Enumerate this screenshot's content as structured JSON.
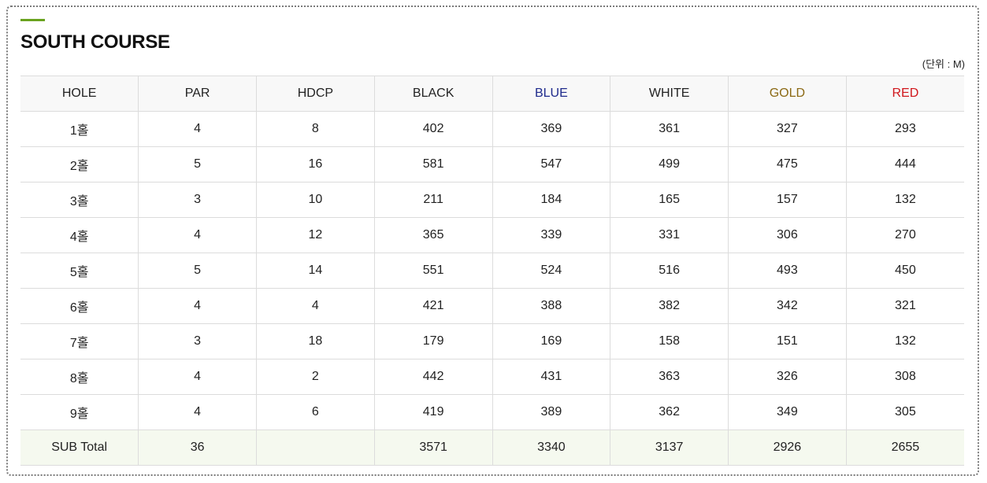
{
  "title": "SOUTH COURSE",
  "unit_label": "(단위 : M)",
  "colors": {
    "accent": "#6aa31f",
    "BLUE": "#1e2a8c",
    "GOLD": "#8b6914",
    "RED": "#d0161b",
    "default_header": "#222222",
    "subtotal_bg": "#f5f9ef",
    "header_bg": "#f8f8f8"
  },
  "table": {
    "headers": [
      {
        "label": "HOLE",
        "color": "#222222"
      },
      {
        "label": "PAR",
        "color": "#222222"
      },
      {
        "label": "HDCP",
        "color": "#222222"
      },
      {
        "label": "BLACK",
        "color": "#222222"
      },
      {
        "label": "BLUE",
        "color": "#1e2a8c"
      },
      {
        "label": "WHITE",
        "color": "#222222"
      },
      {
        "label": "GOLD",
        "color": "#8b6914"
      },
      {
        "label": "RED",
        "color": "#d0161b"
      }
    ],
    "rows": [
      [
        "1홀",
        "4",
        "8",
        "402",
        "369",
        "361",
        "327",
        "293"
      ],
      [
        "2홀",
        "5",
        "16",
        "581",
        "547",
        "499",
        "475",
        "444"
      ],
      [
        "3홀",
        "3",
        "10",
        "211",
        "184",
        "165",
        "157",
        "132"
      ],
      [
        "4홀",
        "4",
        "12",
        "365",
        "339",
        "331",
        "306",
        "270"
      ],
      [
        "5홀",
        "5",
        "14",
        "551",
        "524",
        "516",
        "493",
        "450"
      ],
      [
        "6홀",
        "4",
        "4",
        "421",
        "388",
        "382",
        "342",
        "321"
      ],
      [
        "7홀",
        "3",
        "18",
        "179",
        "169",
        "158",
        "151",
        "132"
      ],
      [
        "8홀",
        "4",
        "2",
        "442",
        "431",
        "363",
        "326",
        "308"
      ],
      [
        "9홀",
        "4",
        "6",
        "419",
        "389",
        "362",
        "349",
        "305"
      ]
    ],
    "subtotal": [
      "SUB Total",
      "36",
      "",
      "3571",
      "3340",
      "3137",
      "2926",
      "2655"
    ]
  }
}
